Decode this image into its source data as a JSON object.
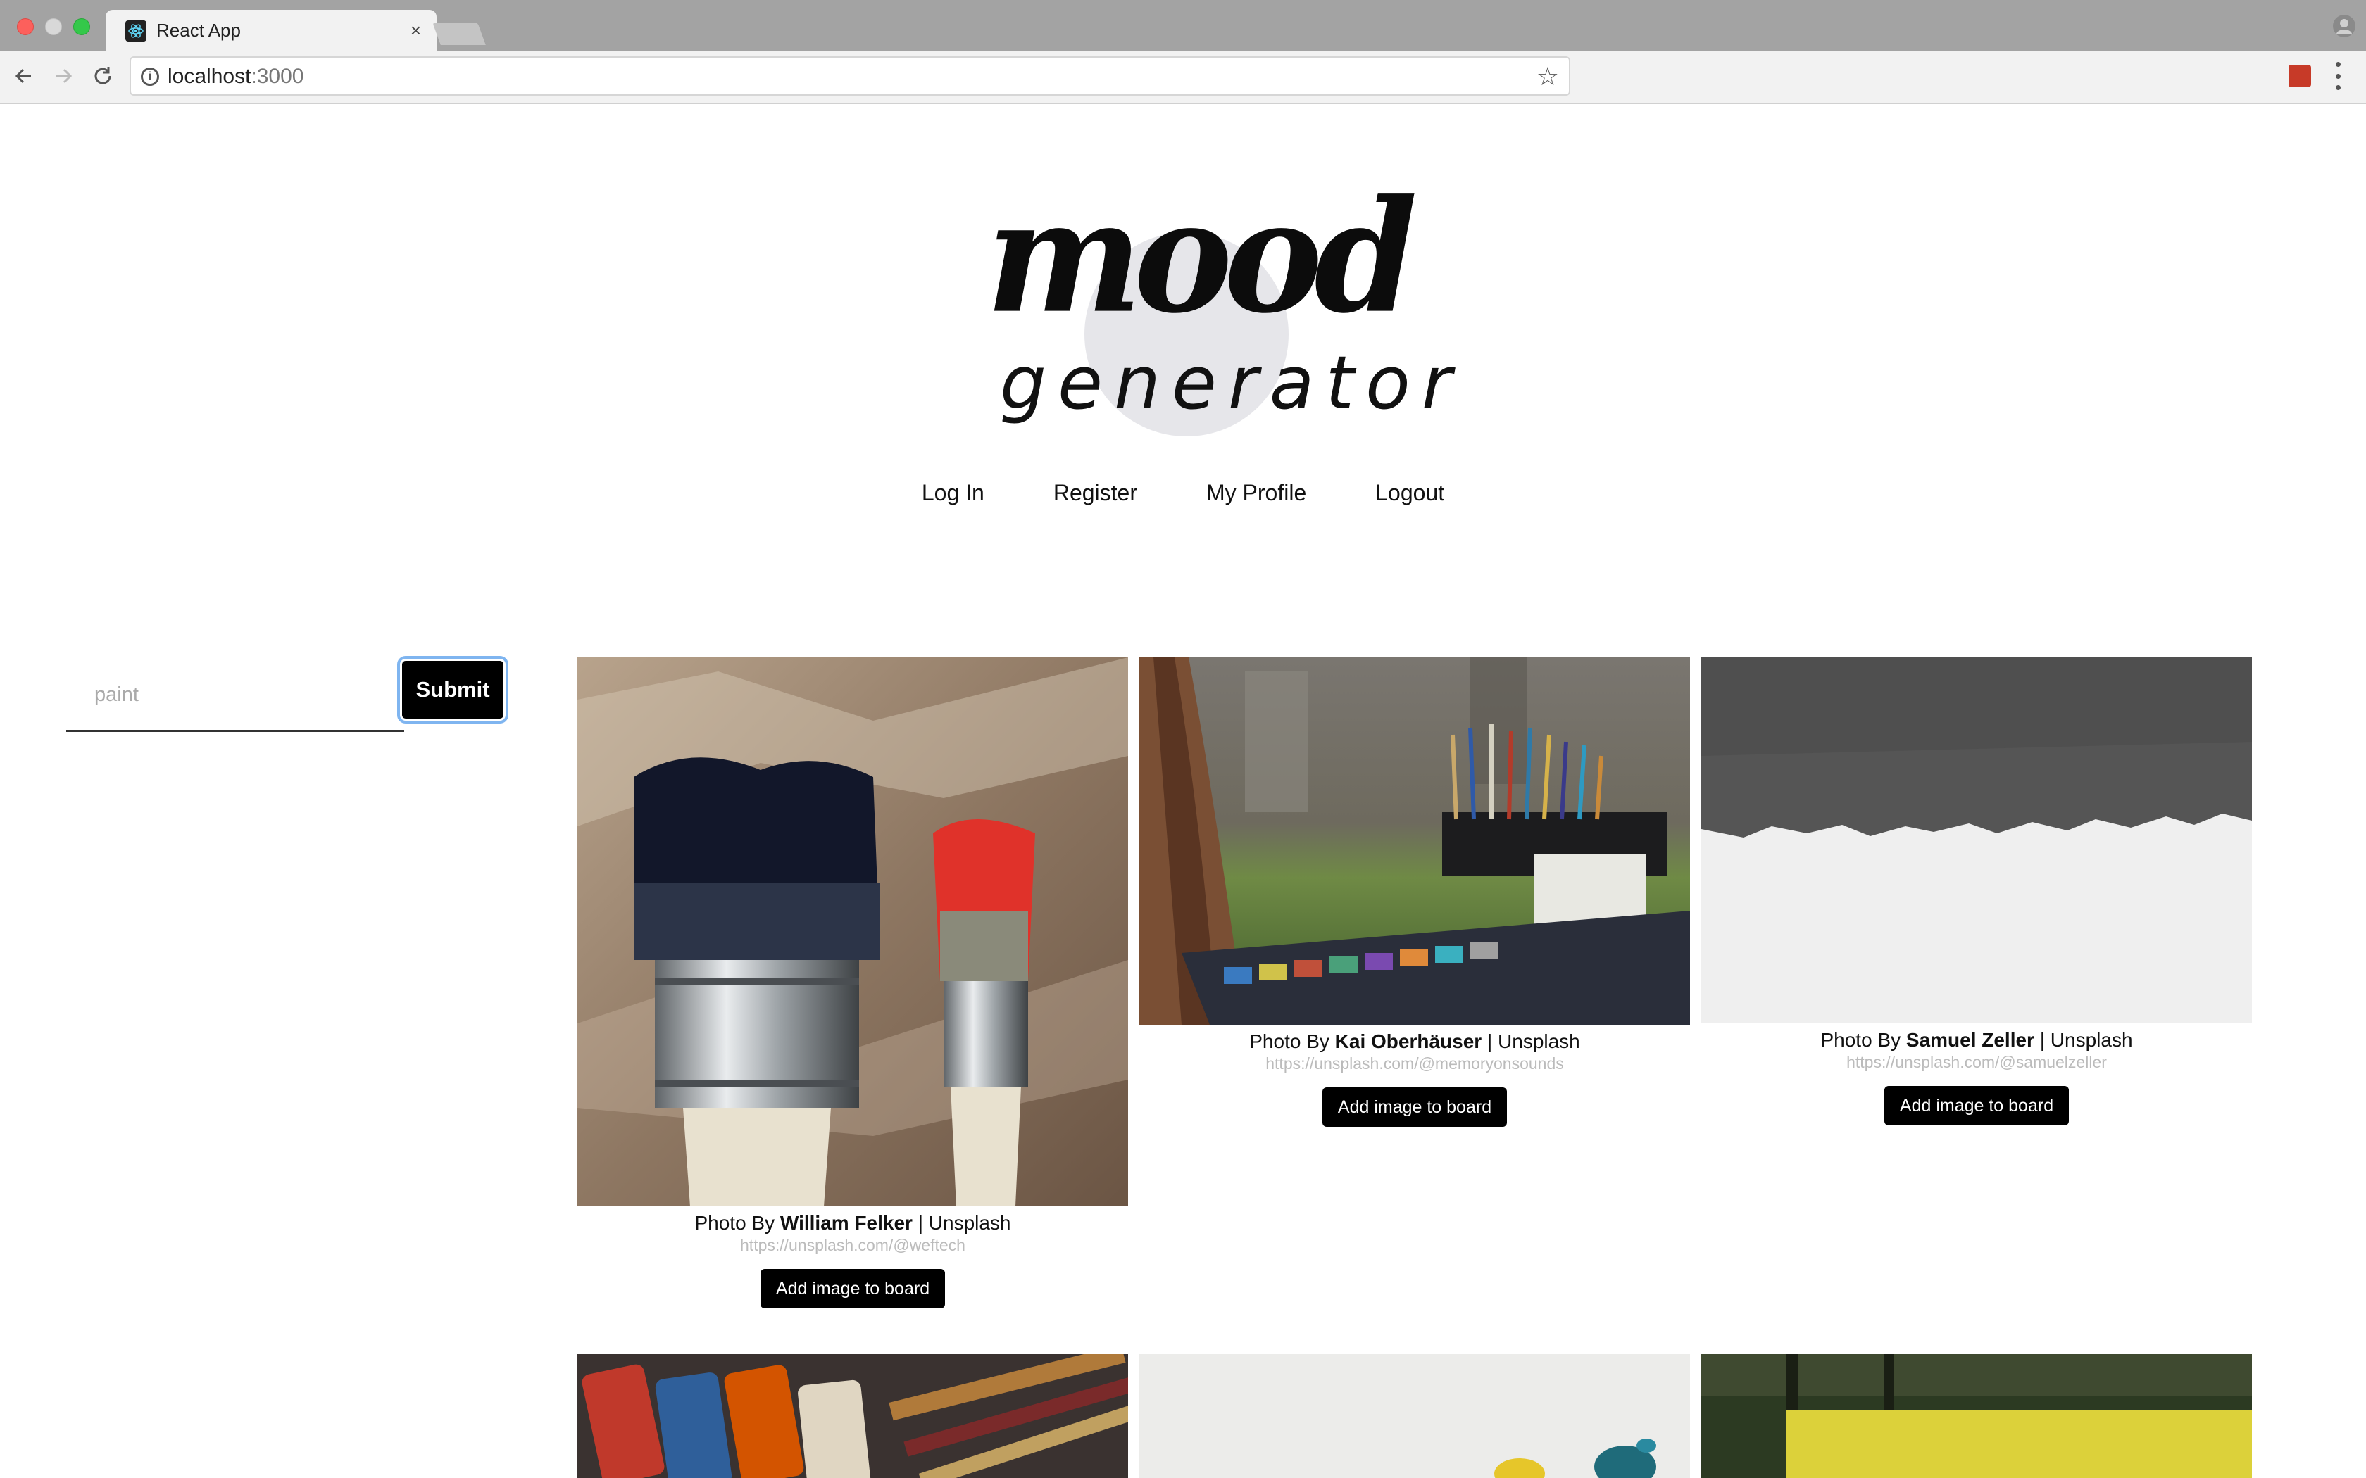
{
  "browser": {
    "tab_title": "React App",
    "tab_close": "×",
    "url_host": "localhost",
    "url_port": ":3000"
  },
  "logo": {
    "line1": "mood",
    "line2": "generator"
  },
  "nav": {
    "login": "Log In",
    "register": "Register",
    "profile": "My Profile",
    "logout": "Logout"
  },
  "search": {
    "placeholder": "paint",
    "value": "",
    "submit_label": "Submit"
  },
  "cards": [
    {
      "prefix": "Photo By ",
      "author": "William Felker",
      "suffix": " | Unsplash",
      "url": "https://unsplash.com/@weftech",
      "button": "Add image to board"
    },
    {
      "prefix": "Photo By ",
      "author": "Kai Oberhäuser",
      "suffix": " | Unsplash",
      "url": "https://unsplash.com/@memoryonsounds",
      "button": "Add image to board"
    },
    {
      "prefix": "Photo By ",
      "author": "Samuel Zeller",
      "suffix": " | Unsplash",
      "url": "https://unsplash.com/@samuelzeller",
      "button": "Add image to board"
    }
  ],
  "colors": {
    "button_bg": "#000000",
    "focus_ring": "#7fb5f0",
    "credit_url": "#bbbbbb"
  }
}
